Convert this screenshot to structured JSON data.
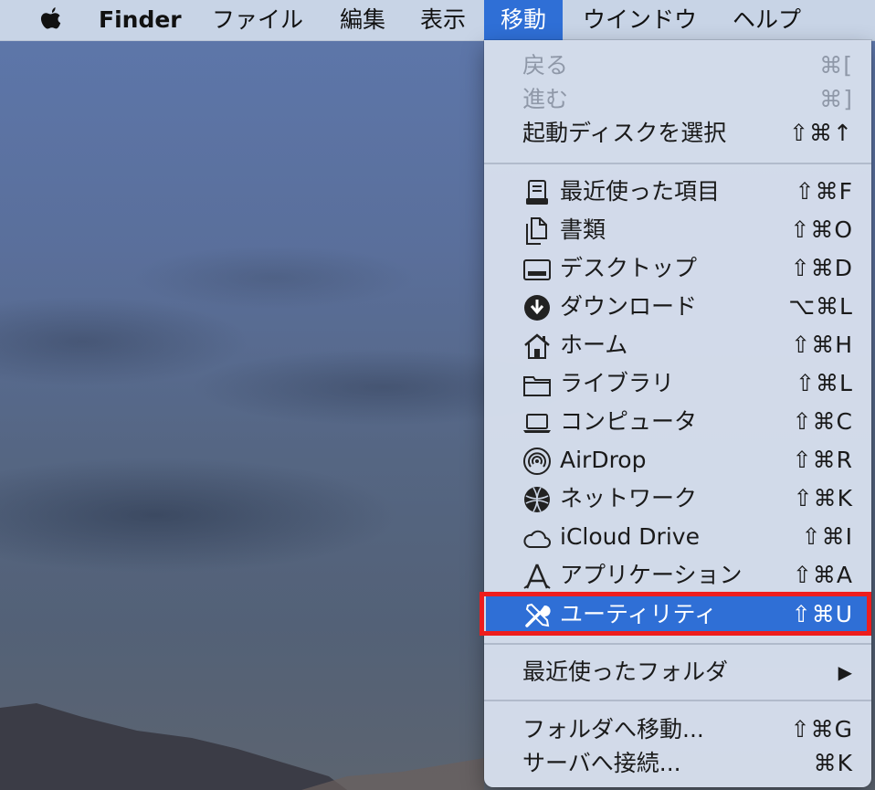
{
  "menubar": {
    "app_name": "Finder",
    "items": [
      "ファイル",
      "編集",
      "表示",
      "移動",
      "ウインドウ",
      "ヘルプ"
    ],
    "active_item": "移動",
    "apple_icon": "apple-logo-icon"
  },
  "menu": {
    "group1": [
      {
        "label": "戻る",
        "shortcut": "⌘[",
        "enabled": false
      },
      {
        "label": "進む",
        "shortcut": "⌘]",
        "enabled": false
      },
      {
        "label": "起動ディスクを選択",
        "shortcut": "⇧⌘↑",
        "enabled": true
      }
    ],
    "group2": [
      {
        "label": "最近使った項目",
        "shortcut": "⇧⌘F",
        "icon": "recents-icon"
      },
      {
        "label": "書類",
        "shortcut": "⇧⌘O",
        "icon": "documents-icon"
      },
      {
        "label": "デスクトップ",
        "shortcut": "⇧⌘D",
        "icon": "desktop-icon"
      },
      {
        "label": "ダウンロード",
        "shortcut": "⌥⌘L",
        "icon": "downloads-icon"
      },
      {
        "label": "ホーム",
        "shortcut": "⇧⌘H",
        "icon": "home-icon"
      },
      {
        "label": "ライブラリ",
        "shortcut": "⇧⌘L",
        "icon": "library-folder-icon"
      },
      {
        "label": "コンピュータ",
        "shortcut": "⇧⌘C",
        "icon": "computer-icon"
      },
      {
        "label": "AirDrop",
        "shortcut": "⇧⌘R",
        "icon": "airdrop-icon"
      },
      {
        "label": "ネットワーク",
        "shortcut": "⇧⌘K",
        "icon": "network-globe-icon"
      },
      {
        "label": "iCloud Drive",
        "shortcut": "⇧⌘I",
        "icon": "icloud-icon"
      },
      {
        "label": "アプリケーション",
        "shortcut": "⇧⌘A",
        "icon": "applications-icon"
      },
      {
        "label": "ユーティリティ",
        "shortcut": "⇧⌘U",
        "icon": "utilities-tools-icon",
        "highlighted": true
      }
    ],
    "group3": [
      {
        "label": "最近使ったフォルダ",
        "submenu_glyph": "▶"
      }
    ],
    "group4": [
      {
        "label": "フォルダへ移動...",
        "shortcut": "⇧⌘G"
      },
      {
        "label": "サーバへ接続...",
        "shortcut": "⌘K"
      }
    ]
  },
  "colors": {
    "highlight": "#2f6fd6",
    "annotation_box": "#ee1d1d"
  }
}
